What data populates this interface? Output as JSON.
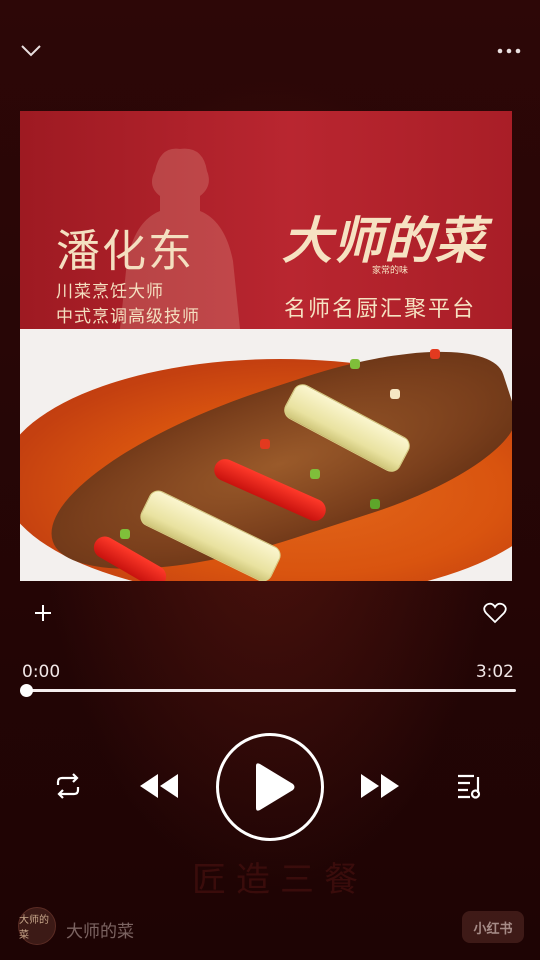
{
  "header": {
    "collapse_icon": "chevron-down-icon",
    "more_icon": "more-horizontal-icon"
  },
  "cover": {
    "master_name": "潘化东",
    "master_title_1": "川菜烹饪大师",
    "master_title_2": "中式烹调高级技师",
    "brand_logo": "大师的菜",
    "brand_tagline_small": "家常的味",
    "slogan": "名师名厨汇聚平台"
  },
  "actions": {
    "add_icon": "plus-icon",
    "favorite_icon": "heart-outline-icon"
  },
  "playback": {
    "current_time": "0:00",
    "total_time": "3:02",
    "progress_fraction": 0.0
  },
  "controls": {
    "repeat_icon": "repeat-icon",
    "previous_icon": "rewind-icon",
    "play_icon": "play-icon",
    "next_icon": "fast-forward-icon",
    "playlist_icon": "playlist-icon"
  },
  "watermark": {
    "text": "匠造三餐"
  },
  "footer": {
    "author_avatar_text": "大师的菜",
    "author_name": "大师的菜",
    "platform_badge": "小红书"
  },
  "colors": {
    "background": "#2a0707",
    "banner_red": "#b92630",
    "banner_text": "#f4dfc0"
  }
}
